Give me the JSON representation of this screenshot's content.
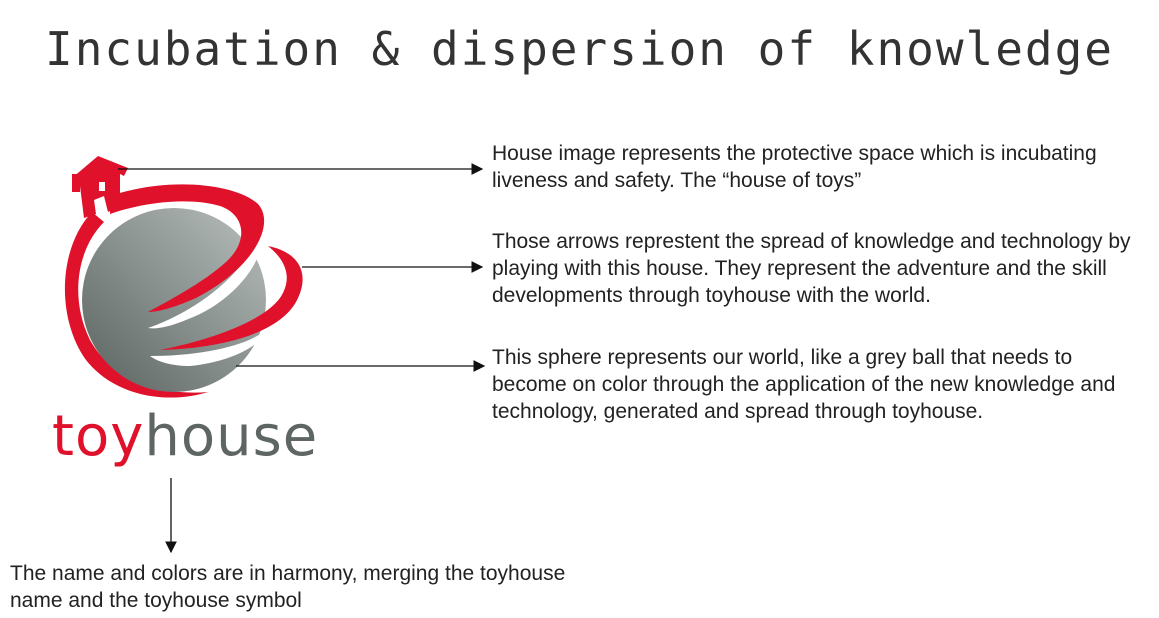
{
  "title": "Incubation & dispersion of knowledge",
  "logo": {
    "name_part_1": "toy",
    "name_part_2": "house",
    "colors": {
      "red": "#e0112b",
      "grey": "#5e6664"
    }
  },
  "annotations": {
    "house": "House image represents the protective space which is incubating liveness and safety. The “house of toys”",
    "arrows": "Those arrows represtent the spread of knowledge and technology by playing with this house. They represent the adventure and the skill developments through toyhouse with the world.",
    "sphere": "This sphere represents our world, like a grey ball that needs to become on color through the application of the new knowledge and technology, generated and spread through toyhouse.",
    "name": "The name and colors are in harmony, merging the toyhouse name and the toyhouse symbol"
  }
}
